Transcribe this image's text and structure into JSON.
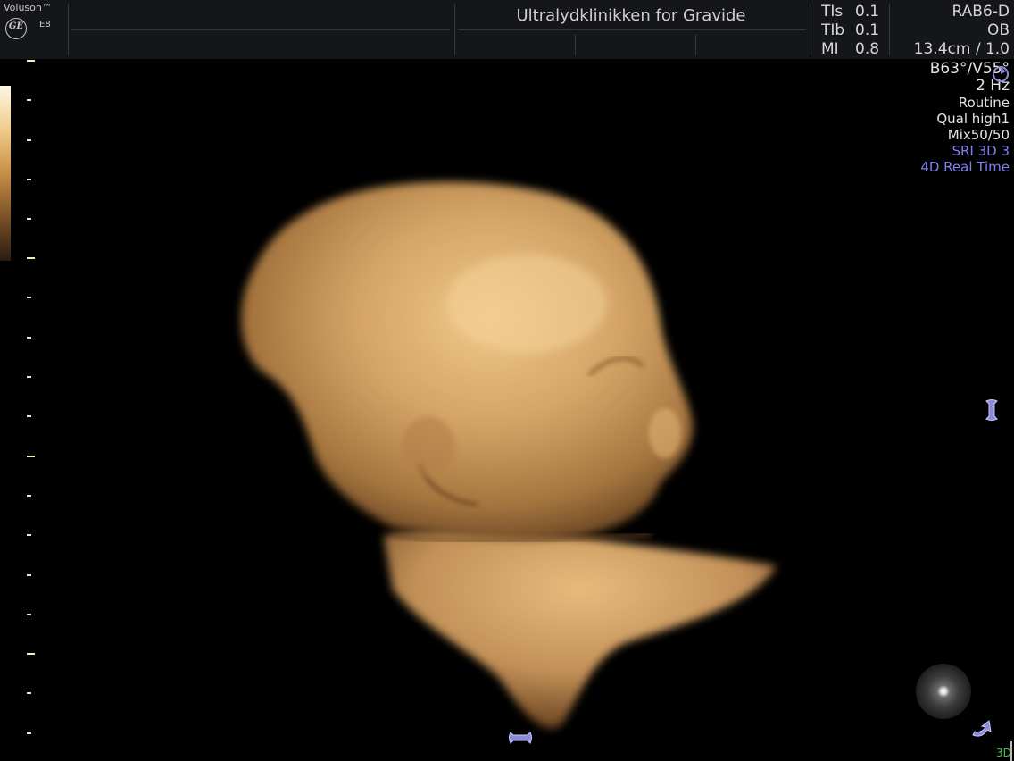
{
  "header": {
    "brand": "Voluson™",
    "model": "E8",
    "logo_text": "GE",
    "clinic": "Ultralydklinikken for Gravide",
    "params": [
      {
        "label": "TIs",
        "value": "0.1"
      },
      {
        "label": "TIb",
        "value": "0.1"
      },
      {
        "label": "MI",
        "value": "0.8"
      }
    ]
  },
  "readout": {
    "probe": "RAB6-D",
    "application": "OB",
    "depth": "13.4cm / 1.0",
    "angles": "B63°/V55°",
    "frame_rate": "2 Hz",
    "preset": "Routine",
    "quality": "Qual high1",
    "mix": "Mix50/50",
    "sri": "SRI 3D 3",
    "mode": "4D Real Time"
  },
  "footer": {
    "mode_label": "3D"
  },
  "colors": {
    "background": "#000000",
    "header": "#151619",
    "render_tint": "#c99a60",
    "accent_blue": "#7f7ff0",
    "status_green": "#4fc24f"
  },
  "icons": [
    "ge-logo-icon",
    "sector-rotate-icon",
    "vertical-axis-icon",
    "horizontal-axis-icon",
    "z-rotate-icon",
    "light-source-icon"
  ]
}
